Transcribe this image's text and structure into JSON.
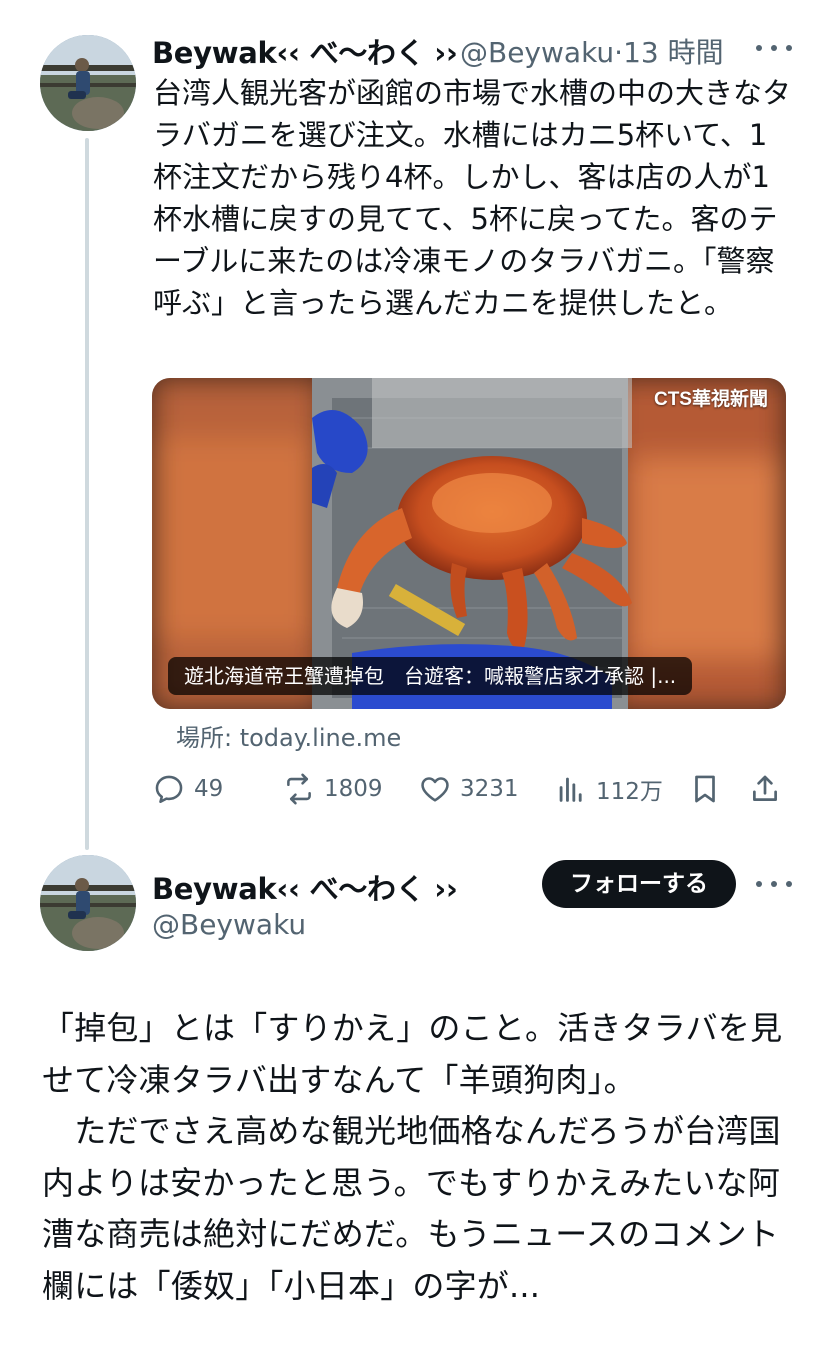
{
  "first_tweet": {
    "display_name": "Beywak‹‹ べ〜わく ››",
    "handle": "@Beywaku",
    "separator": "·",
    "timestamp": "13 時間",
    "more_icon": "more-dots-icon",
    "text": "台湾人観光客が函館の市場で水槽の中の大きなタラバガニを選び注文。水槽にはカニ5杯いて、1杯注文だから残り4杯。しかし、客は店の人が1杯水槽に戻すの見てて、5杯に戻ってた。客のテーブルに来たのは冷凍モノのタラバガニ。「警察呼ぶ」と言ったら選んだカニを提供したと。",
    "media": {
      "logo_text": "CTS華視新聞",
      "caption": "遊北海道帝王蟹遭掉包　台遊客：喊報警店家才承認 |..."
    },
    "source_link": "場所: today.line.me",
    "actions": {
      "reply": {
        "icon": "reply-icon",
        "count": "49"
      },
      "retweet": {
        "icon": "retweet-icon",
        "count": "1809"
      },
      "like": {
        "icon": "heart-icon",
        "count": "3231"
      },
      "views": {
        "icon": "views-chart-icon",
        "count": "112万"
      },
      "bookmark": {
        "icon": "bookmark-icon"
      },
      "share": {
        "icon": "share-icon"
      }
    }
  },
  "second_tweet": {
    "display_name": "Beywak‹‹ べ〜わく ››",
    "handle": "@Beywaku",
    "follow_label": "フォローする",
    "more_icon": "more-dots-icon",
    "text": "「掉包」とは「すりかえ」のこと。活きタラバを見せて冷凍タラバ出すなんて「羊頭狗肉」。\n　ただでさえ高めな観光地価格なんだろうが台湾国内よりは安かったと思う。でもすりかえみたいな阿漕な商売は絶対にだめだ。もうニュースのコメント欄には「倭奴」「小日本」の字が..."
  },
  "colors": {
    "text": "#0f1419",
    "muted": "#536471",
    "thread_line": "#cfd9de",
    "follow_bg": "#0f1419"
  }
}
